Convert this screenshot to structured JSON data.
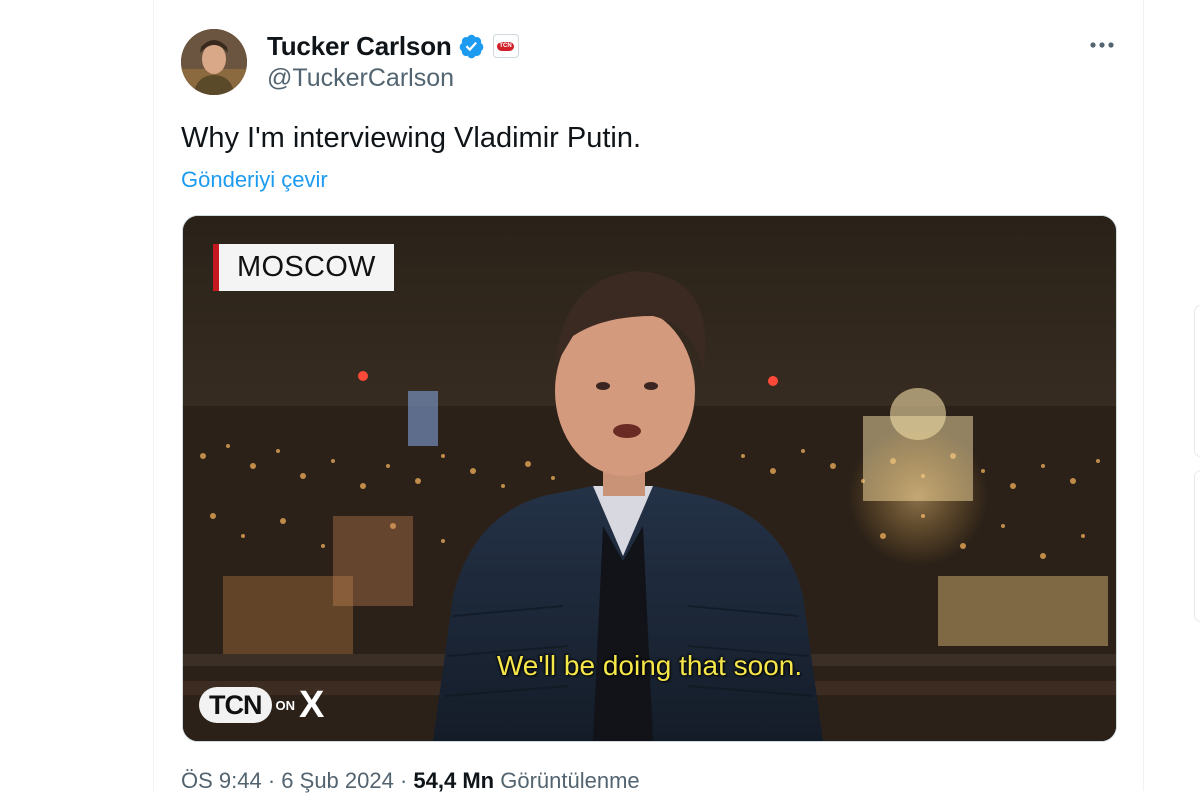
{
  "author": {
    "display_name": "Tucker Carlson",
    "handle": "@TuckerCarlson",
    "verified": true,
    "affiliate_badge": "TCN"
  },
  "tweet": {
    "text": "Why I'm interviewing Vladimir Putin.",
    "translate_label": "Gönderiyi çevir"
  },
  "media": {
    "location_label": "MOSCOW",
    "caption": "We'll be doing that soon.",
    "logo_brand": "TCN",
    "logo_on": "ON",
    "logo_x": "X"
  },
  "meta": {
    "time": "ÖS 9:44",
    "separator": "·",
    "date": "6 Şub 2024",
    "views_count": "54,4 Mn",
    "views_label": "Görüntülenme"
  },
  "icons": {
    "verified": "verified-badge-icon",
    "more": "more-options-icon"
  },
  "colors": {
    "accent": "#1d9bf0",
    "verified_blue": "#1d9bf0",
    "caption_yellow": "#f5e64a",
    "location_red": "#c41920"
  }
}
